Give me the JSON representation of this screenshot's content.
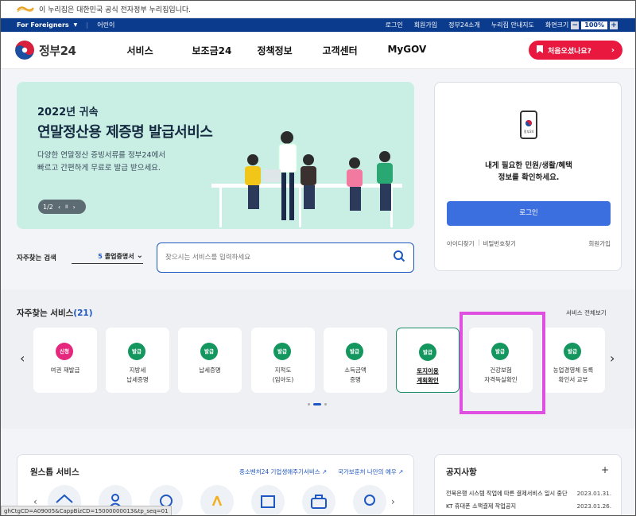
{
  "gov_banner": {
    "text": "이 누리집은 대한민국 공식 전자정부 누리집입니다."
  },
  "util": {
    "foreigners": "For Foreigners",
    "kids": "어린이",
    "links": [
      "로그인",
      "회원가입",
      "정부24소개",
      "누리집 안내지도"
    ],
    "zoom_label": "화면크기",
    "zoom_value": "100%",
    "zoom_minus": "−",
    "zoom_plus": "+"
  },
  "header": {
    "logo_text": "정부24",
    "nav": [
      "서비스",
      "보조금24",
      "정책정보",
      "고객센터",
      "MyGOV"
    ],
    "first_visit": "처음오셨나요?",
    "first_visit_arrow": "›"
  },
  "hero": {
    "eyebrow": "2022년 귀속",
    "title": "연말정산용 제증명 발급서비스",
    "desc_line1": "다양한 연말정산 증빙서류를 정부24에서",
    "desc_line2": "빠르고 간편하게 무료로 발급 받으세요.",
    "pager": "1/2",
    "pager_prev": "‹",
    "pager_pause": "II",
    "pager_next": "›"
  },
  "login": {
    "phone_label": "정부24",
    "message_line1": "내게 필요한 민원/생활/혜택",
    "message_line2": "정보를 확인하세요.",
    "button": "로그인",
    "find_id": "아이디찾기",
    "find_pw": "비밀번호찾기",
    "join": "회원가입"
  },
  "search": {
    "label": "자주찾는 검색",
    "select_rank": "5",
    "select_value": "졸업증명서",
    "select_arrow": "⌄",
    "placeholder": "찾으시는 서비스를 입력하세요"
  },
  "frequent": {
    "title": "자주찾는 서비스",
    "count": "(21)",
    "view_all": "서비스 전체보기",
    "prev": "‹",
    "next": "›",
    "items": [
      {
        "badge": "신청",
        "line1": "여권 재발급",
        "line2": ""
      },
      {
        "badge": "발급",
        "line1": "지방세",
        "line2": "납세증명"
      },
      {
        "badge": "발급",
        "line1": "납세증명",
        "line2": ""
      },
      {
        "badge": "발급",
        "line1": "지적도",
        "line2": "(임야도)"
      },
      {
        "badge": "발급",
        "line1": "소득금액",
        "line2": "증명"
      },
      {
        "badge": "발급",
        "line1": "토지이용",
        "line2": "계획확인"
      },
      {
        "badge": "발급",
        "line1": "건강보험",
        "line2": "자격득실확인"
      },
      {
        "badge": "발급",
        "line1": "농업경영체 등록",
        "line2": "확인서 교부"
      }
    ],
    "colors": {
      "green_badge": "#14965f",
      "pink_badge": "#e5287d",
      "highlight": "#e050e0"
    }
  },
  "onestop": {
    "title": "원스톱 서비스",
    "link1": "중소벤처24 기업생애주기서비스 ↗",
    "link2": "국가보훈처 나만의 예우 ↗",
    "prev": "‹",
    "next": "›",
    "icons": [
      "house-icon",
      "person-icon",
      "baby-icon",
      "ribbon-icon",
      "book-icon",
      "briefcase-icon",
      "elder-icon"
    ]
  },
  "notice": {
    "title": "공지사항",
    "more": "+",
    "rows": [
      {
        "text": "전북은행 시스템 작업에 따른 결제서비스 일시 중단",
        "date": "2023.01.31."
      },
      {
        "text": "KT 휴대폰 소액결제 작업공지",
        "date": "2023.01.26."
      }
    ]
  },
  "status_url": "ghCtgCD=A09005&CappBizCD=15000000013&tp_seq=01"
}
